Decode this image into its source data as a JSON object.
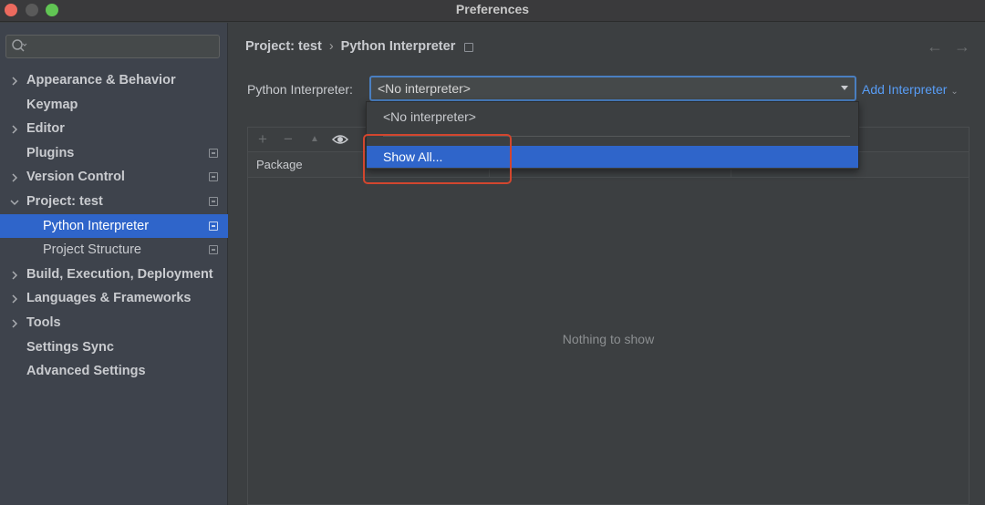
{
  "window": {
    "title": "Preferences"
  },
  "sidebar": {
    "search": {
      "value": "",
      "placeholder": ""
    },
    "items": [
      {
        "label": "Appearance & Behavior",
        "expandable": true
      },
      {
        "label": "Keymap",
        "expandable": false
      },
      {
        "label": "Editor",
        "expandable": true
      },
      {
        "label": "Plugins",
        "expandable": false
      },
      {
        "label": "Version Control",
        "expandable": true
      },
      {
        "label": "Project: test",
        "expandable": true,
        "expanded": true
      },
      {
        "label": "Python Interpreter",
        "selected": true
      },
      {
        "label": "Project Structure"
      },
      {
        "label": "Build, Execution, Deployment",
        "expandable": true
      },
      {
        "label": "Languages & Frameworks",
        "expandable": true
      },
      {
        "label": "Tools",
        "expandable": true
      },
      {
        "label": "Settings Sync",
        "expandable": false
      },
      {
        "label": "Advanced Settings",
        "expandable": false
      }
    ]
  },
  "breadcrumb": {
    "parent": "Project: test",
    "separator": "›",
    "current": "Python Interpreter"
  },
  "nav": {
    "back": "←",
    "forward": "→"
  },
  "interpreter": {
    "label": "Python Interpreter:",
    "selected": "<No interpreter>",
    "add_label": "Add Interpreter"
  },
  "dropdown": {
    "options": [
      "<No interpreter>",
      "Show All..."
    ],
    "highlighted": "Show All..."
  },
  "packages": {
    "toolbar": {
      "add": "+",
      "remove": "−",
      "up": "▲",
      "eye": "👁"
    },
    "columns": [
      "Package",
      "",
      ""
    ],
    "empty_text": "Nothing to show"
  },
  "colors": {
    "accent": "#2f65ca",
    "link": "#589df6",
    "highlight_border": "#d2462e",
    "background": "#3c3f41",
    "sidebar_bg": "#3e434c"
  }
}
